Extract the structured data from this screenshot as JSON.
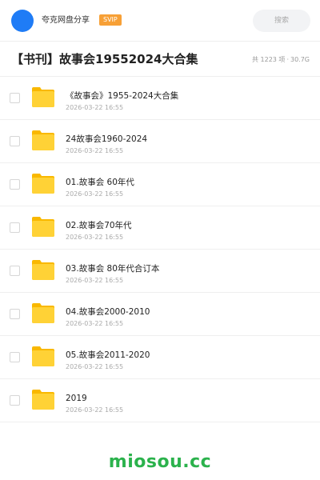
{
  "header": {
    "share_name": "夸克网盘分享",
    "badge": "SVIP",
    "search_placeholder": "搜索",
    "accent_color": "#1f7cf6",
    "badge_color": "#f7a036"
  },
  "title_bar": {
    "title": "【书刊】故事会19552024大合集",
    "item_count": "共 1223 项",
    "separator": "·",
    "total_size": "30.7G"
  },
  "files": [
    {
      "icon": "folder-icon",
      "name": "《故事会》1955-2024大合集",
      "date": "2026-03-22 16:55"
    },
    {
      "icon": "folder-icon",
      "name": "24故事会1960-2024",
      "date": "2026-03-22 16:55"
    },
    {
      "icon": "folder-icon",
      "name": "01.故事会 60年代",
      "date": "2026-03-22 16:55"
    },
    {
      "icon": "folder-icon",
      "name": "02.故事会70年代",
      "date": "2026-03-22 16:55"
    },
    {
      "icon": "folder-icon",
      "name": "03.故事会 80年代合订本",
      "date": "2026-03-22 16:55"
    },
    {
      "icon": "folder-icon",
      "name": "04.故事会2000-2010",
      "date": "2026-03-22 16:55"
    },
    {
      "icon": "folder-icon",
      "name": "05.故事会2011-2020",
      "date": "2026-03-22 16:55"
    },
    {
      "icon": "folder-icon",
      "name": "2019",
      "date": "2026-03-22 16:55"
    }
  ],
  "watermark": "miosou.cc"
}
